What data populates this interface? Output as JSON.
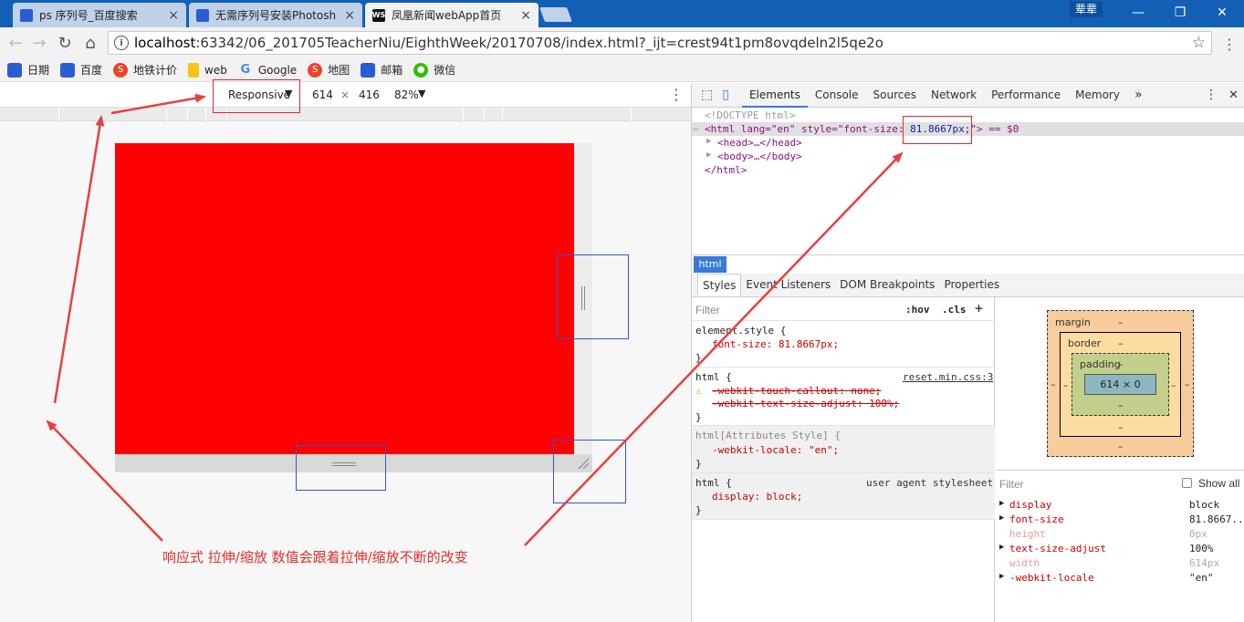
{
  "browser": {
    "tabs": [
      {
        "title": "ps 序列号_百度搜索",
        "icon": "baidu-paw-icon",
        "active": false
      },
      {
        "title": "无需序列号安装Photosh",
        "icon": "baidu-paw-icon",
        "active": false
      },
      {
        "title": "凤凰新闻webApp首页",
        "icon": "webstorm-icon",
        "active": true
      }
    ],
    "user_label": "辈辈",
    "url_host": "localhost",
    "url_rest": ":63342/06_201705TeacherNiu/EighthWeek/20170708/index.html?_ijt=crest94t1pm8ovqdeln2l5qe2o",
    "bookmarks": [
      {
        "label": "日期",
        "icon": "baidu-paw-icon",
        "color": "#2b5bd6"
      },
      {
        "label": "百度",
        "icon": "baidu-paw-icon",
        "color": "#2b5bd6"
      },
      {
        "label": "地铁计价",
        "icon": "sogou-icon",
        "color": "#e8452c"
      },
      {
        "label": "web",
        "icon": "folder-icon",
        "color": "#f5c518"
      },
      {
        "label": "Google",
        "icon": "google-icon",
        "color": "#4285f4"
      },
      {
        "label": "地图",
        "icon": "sogou-icon",
        "color": "#e8452c"
      },
      {
        "label": "邮箱",
        "icon": "paw-icon",
        "color": "#2b5bd6"
      },
      {
        "label": "微信",
        "icon": "wechat-icon",
        "color": "#2dc100"
      }
    ]
  },
  "device_toolbar": {
    "mode": "Responsive",
    "width": "614",
    "times": "×",
    "height": "416",
    "zoom": "82%"
  },
  "devtools": {
    "tabs": [
      "Elements",
      "Console",
      "Sources",
      "Network",
      "Performance",
      "Memory"
    ],
    "more": "»",
    "dom": {
      "doctype": "<!DOCTYPE html>",
      "html_open_pre": "<html lang=\"en\" style=\"font-size: ",
      "html_font_size": "81.8667px;",
      "html_open_post": "\"> == $0",
      "head": "<head>…</head>",
      "body": "<body>…</body>",
      "html_close": "</html>"
    },
    "breadcrumb": "html",
    "subtabs": [
      "Styles",
      "Event Listeners",
      "DOM Breakpoints",
      "Properties"
    ],
    "filter_placeholder": "Filter",
    "hov": ":hov",
    "cls": ".cls",
    "plus": "+",
    "rules": {
      "element_style_sel": "element.style {",
      "element_style_decl": "font-size: 81.8667px;",
      "html_sel": "html {",
      "html_src": "reset.min.css:3",
      "html_decl1": "-webkit-touch-callout: none;",
      "html_decl2": "-webkit-text-size-adjust: 100%;",
      "attr_sel": "html[Attributes Style] {",
      "attr_decl": "-webkit-locale: \"en\";",
      "ua_sel": "html {",
      "ua_src": "user agent stylesheet",
      "ua_decl": "display: block;",
      "close": "}"
    },
    "box_model": {
      "margin": "margin",
      "border": "border",
      "padding": "padding",
      "dash": "–",
      "content": "614 × 0"
    },
    "computed": {
      "filter": "Filter",
      "show_all": "Show all",
      "props": [
        {
          "name": "display",
          "value": "block",
          "inherited": true
        },
        {
          "name": "font-size",
          "value": "81.8667...",
          "inherited": true
        },
        {
          "name": "height",
          "value": "0px",
          "inherited": false
        },
        {
          "name": "text-size-adjust",
          "value": "100%",
          "inherited": true
        },
        {
          "name": "width",
          "value": "614px",
          "inherited": false
        },
        {
          "name": "-webkit-locale",
          "value": "\"en\"",
          "inherited": true
        }
      ]
    }
  },
  "annotation": {
    "note": "响应式 拉伸/缩放  数值会跟着拉伸/缩放不断的改变",
    "color": "#e03030"
  }
}
